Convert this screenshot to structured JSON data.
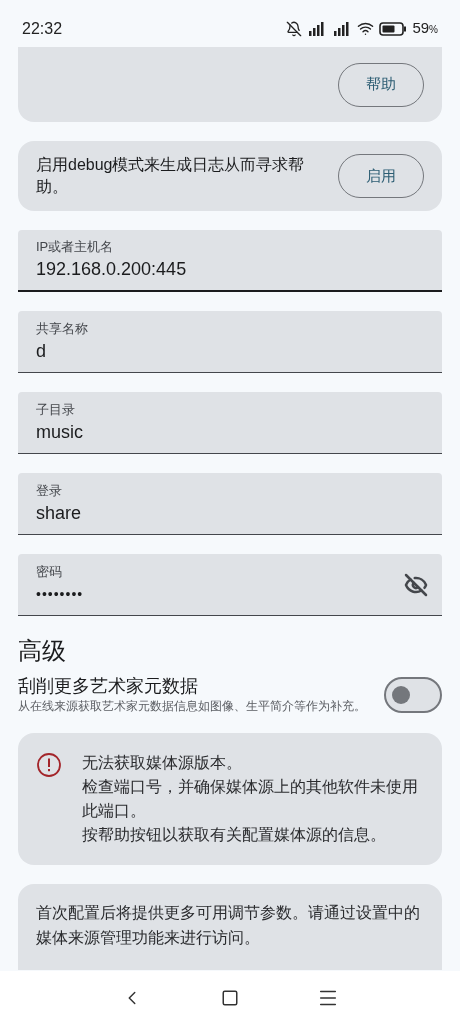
{
  "status_bar": {
    "time": "22:32",
    "battery": "59",
    "battery_unit": "%"
  },
  "help_card": {
    "button": "帮助"
  },
  "debug_card": {
    "text": "启用debug模式来生成日志从而寻求帮助。",
    "button": "启用"
  },
  "fields": [
    {
      "kind": "text",
      "label": "IP或者主机名",
      "value": "192.168.0.200:445",
      "focused": true
    },
    {
      "kind": "text",
      "label": "共享名称",
      "value": "d",
      "focused": false
    },
    {
      "kind": "text",
      "label": "子目录",
      "value": "music",
      "focused": false
    },
    {
      "kind": "text",
      "label": "登录",
      "value": "share",
      "focused": false
    },
    {
      "kind": "password",
      "label": "密码",
      "value": "••••••••",
      "focused": false
    }
  ],
  "advanced": {
    "heading": "高级",
    "toggle": {
      "title": "刮削更多艺术家元数据",
      "description": "从在线来源获取艺术家元数据信息如图像、生平简介等作为补充。",
      "on": false
    }
  },
  "error_card": {
    "lines": [
      "无法获取媒体源版本。",
      "检查端口号，并确保媒体源上的其他软件未使用此端口。",
      "按帮助按钮以获取有关配置媒体源的信息。"
    ]
  },
  "info_card": {
    "text": "首次配置后将提供更多可用调节参数。请通过设置中的媒体来源管理功能来进行访问。"
  }
}
